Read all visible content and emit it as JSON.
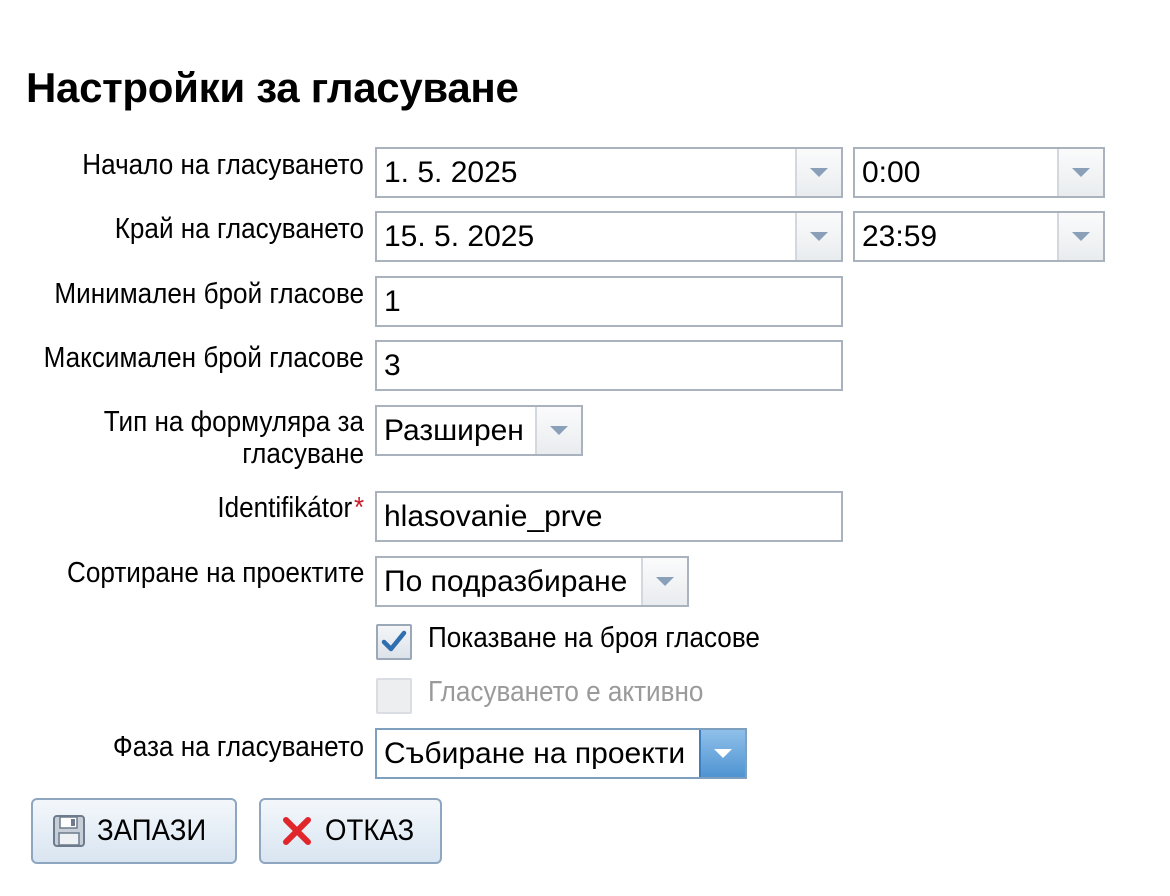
{
  "page": {
    "title": "Настройки за гласуване"
  },
  "form": {
    "start": {
      "label": "Начало на гласуването",
      "date": "1. 5. 2025",
      "time": "0:00"
    },
    "end": {
      "label": "Край на гласуването",
      "date": "15. 5. 2025",
      "time": "23:59"
    },
    "min_votes": {
      "label": "Минимален брой гласове",
      "value": "1"
    },
    "max_votes": {
      "label": "Максимален брой гласове",
      "value": "3"
    },
    "form_type": {
      "label": "Тип на формуляра за гласуване",
      "value": "Разширен"
    },
    "identifier": {
      "label": "Identifikátor",
      "required_mark": "*",
      "value": "hlasovanie_prve"
    },
    "sorting": {
      "label": "Сортиране на проектите",
      "value": "По подразбиране"
    },
    "show_vote_count": {
      "label": "Показване на броя гласове",
      "checked": true
    },
    "voting_active": {
      "label": "Гласуването е активно",
      "checked": false,
      "disabled": true
    },
    "phase": {
      "label": "Фаза на гласуването",
      "value": "Събиране на проекти"
    }
  },
  "actions": {
    "save_label": "ЗАПАЗИ",
    "cancel_label": "ОТКАЗ"
  },
  "icons": {
    "dropdown": "chevron-down-icon",
    "save": "floppy-disk-icon",
    "cancel": "red-x-icon",
    "check": "checkmark-icon"
  },
  "colors": {
    "field_border": "#a9b2bd",
    "required": "#c8202a",
    "accent_blue": "#4f94d2",
    "cancel_red": "#e0262b",
    "checkmark": "#2f6fb0",
    "disabled_text": "#9a9a9a"
  }
}
